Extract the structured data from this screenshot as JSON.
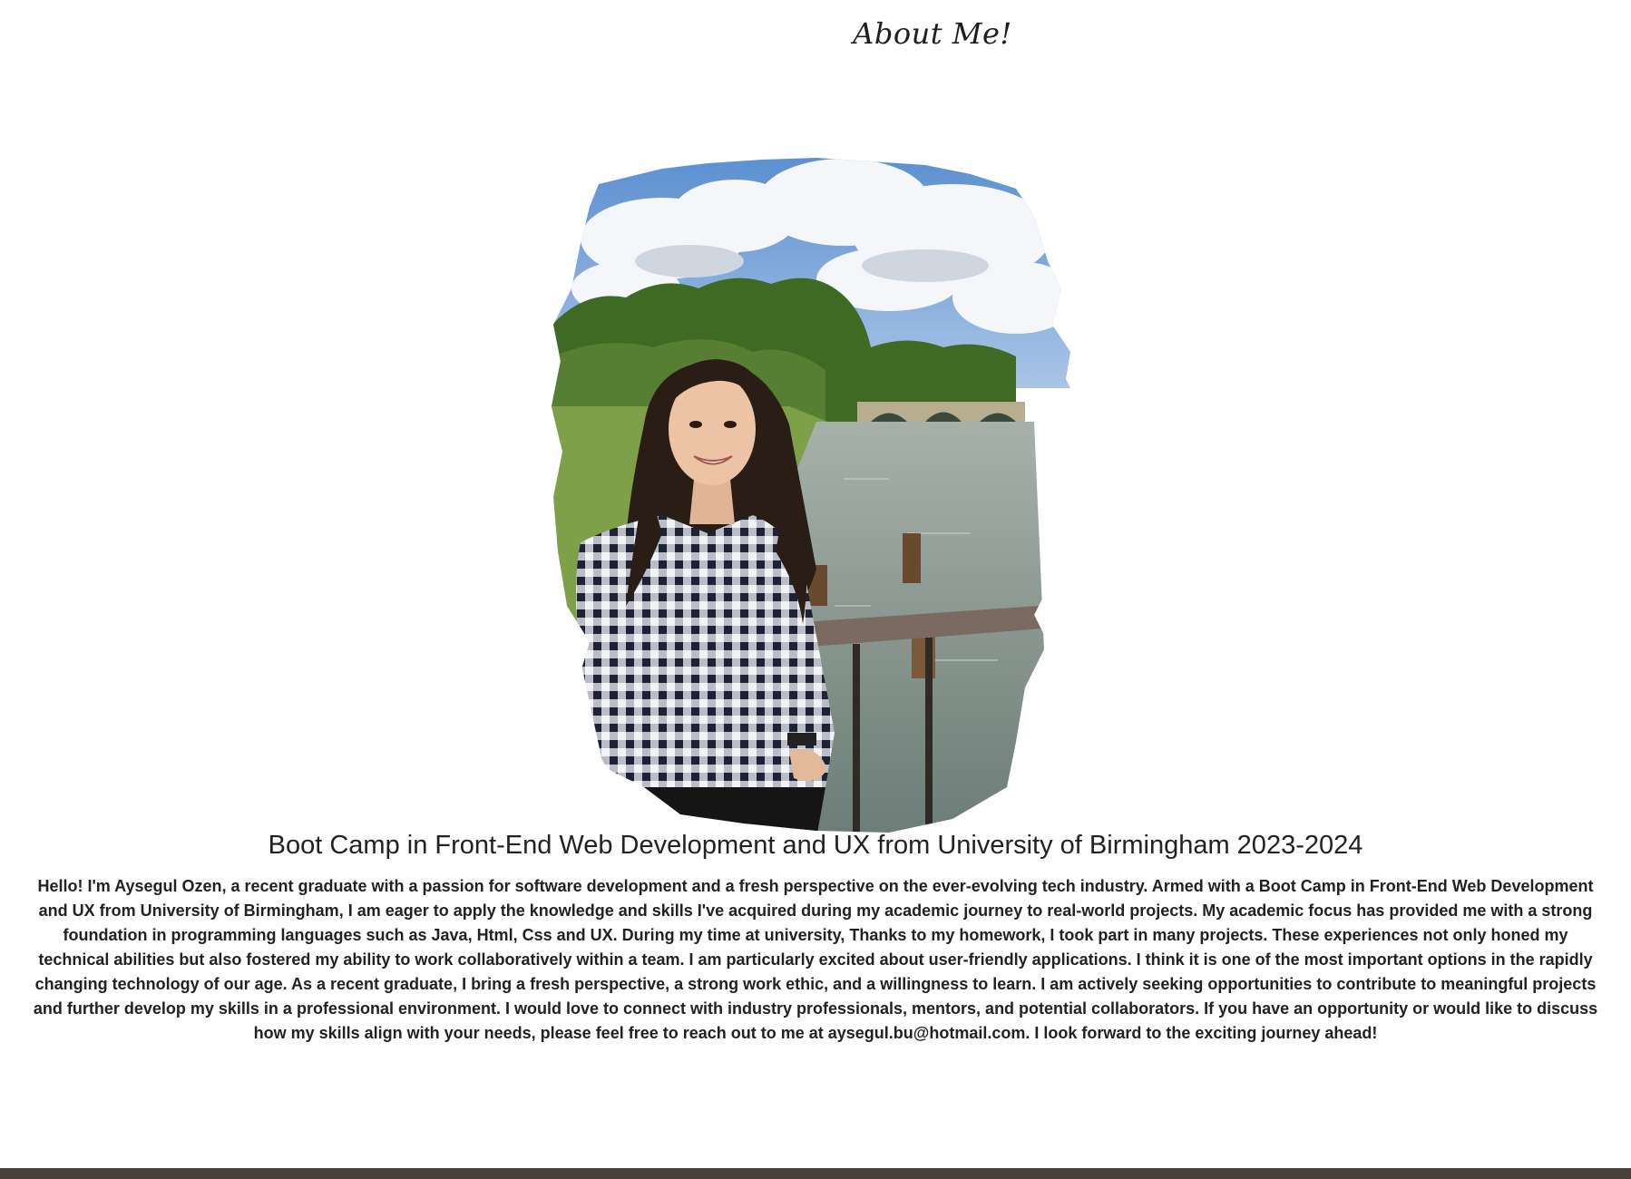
{
  "page": {
    "title": "About Me!"
  },
  "profile": {
    "headline": "Boot Camp in Front-End Web Development and UX from University of Birmingham 2023-2024",
    "bio": "Hello! I'm Aysegul Ozen, a recent graduate with a passion for software development and a fresh perspective on the ever-evolving tech industry. Armed with a Boot Camp in Front-End Web Development and UX from University of Birmingham, I am eager to apply the knowledge and skills I've acquired during my academic journey to real-world projects. My academic focus has provided me with a strong foundation in programming languages such as Java, Html, Css and UX. During my time at university, Thanks to my homework, I took part in many projects. These experiences not only honed my technical abilities but also fostered my ability to work collaboratively within a team. I am particularly excited about user-friendly applications. I think it is one of the most important options in the rapidly changing technology of our age. As a recent graduate, I bring a fresh perspective, a strong work ethic, and a willingness to learn. I am actively seeking opportunities to contribute to meaningful projects and further develop my skills in a professional environment. I would love to connect with industry professionals, mentors, and potential collaborators. If you have an opportunity or would like to discuss how my skills align with your needs, please feel free to reach out to me at aysegul.bu@hotmail.com. I look forward to the exciting journey ahead!"
  },
  "colors": {
    "text": "#222222",
    "footer": "#4a403a",
    "sky": "#6f9fd8",
    "foliage": "#4f7a2e",
    "river": "#8c9a94",
    "shirt": "#1f2235"
  }
}
